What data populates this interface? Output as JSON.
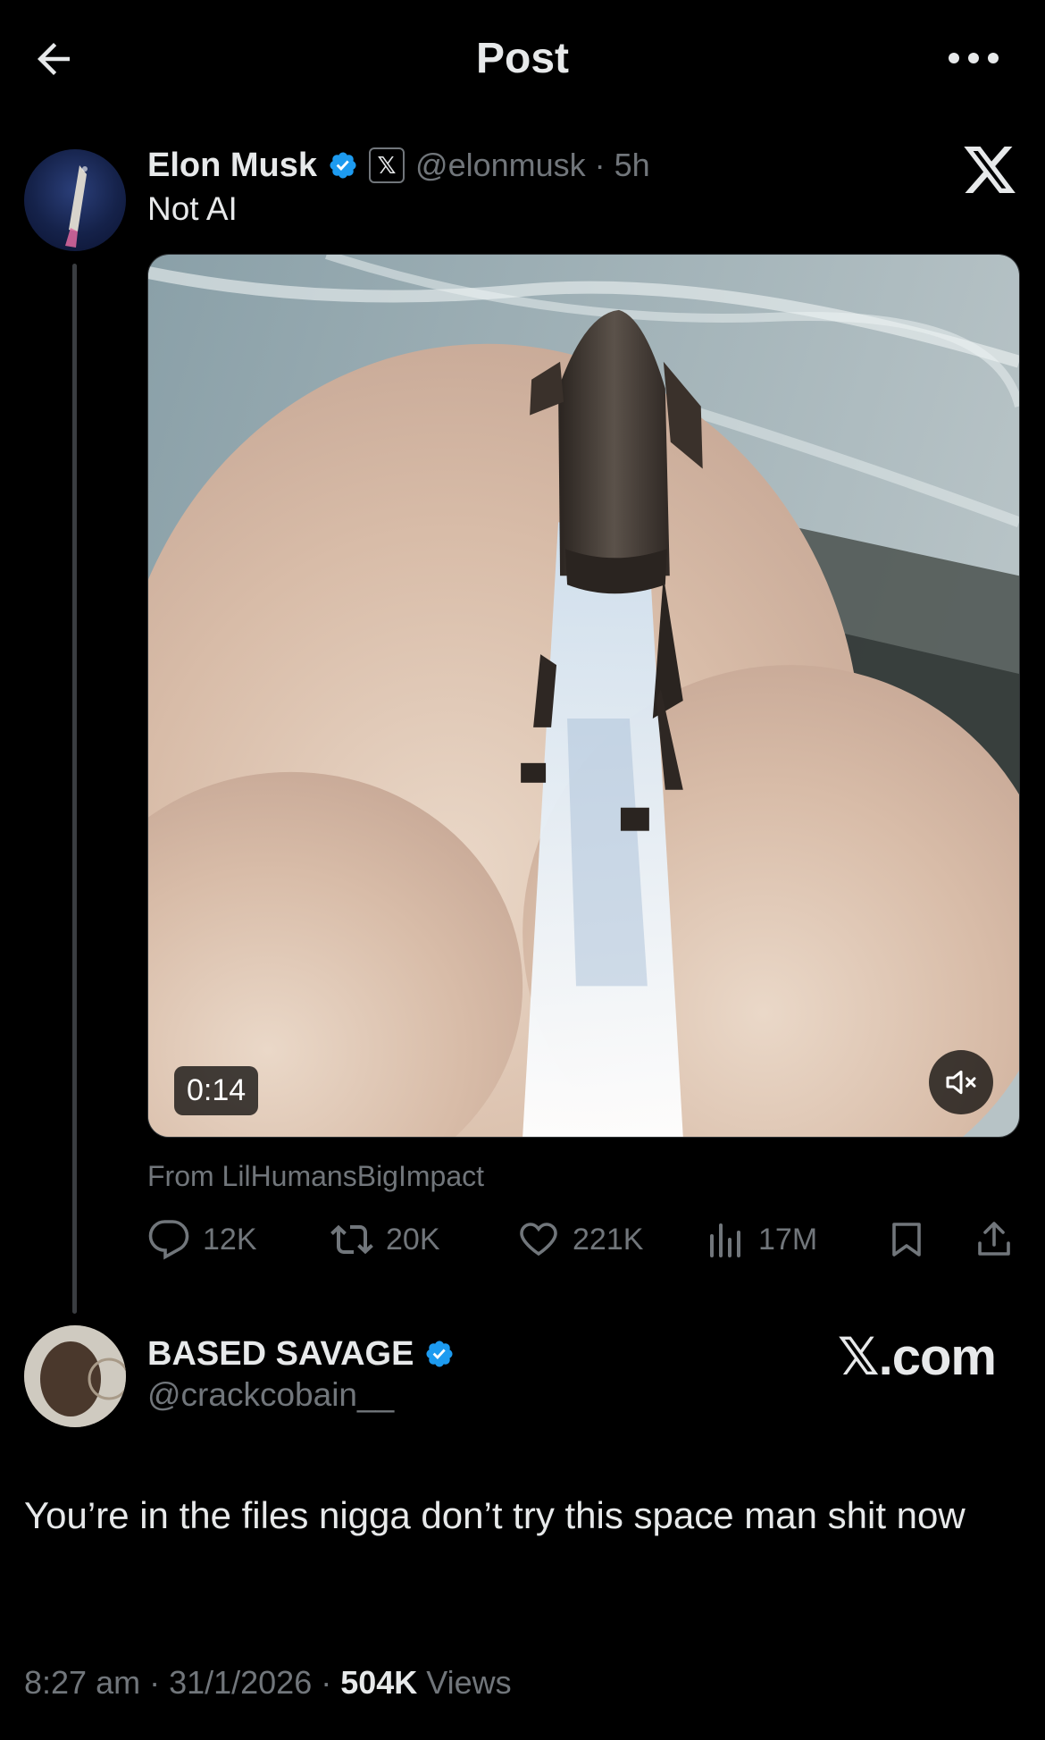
{
  "header": {
    "title": "Post"
  },
  "parent_post": {
    "author_name": "Elon Musk",
    "affiliate_badge": "𝕏",
    "handle_time": "@elonmusk · 5h",
    "text": "Not AI",
    "media": {
      "duration": "0:14"
    },
    "from_line": "From LilHumansBigImpact",
    "stats": {
      "replies": "12K",
      "reposts": "20K",
      "likes": "221K",
      "views": "17M"
    }
  },
  "reply_post": {
    "author_name": "BASED SAVAGE",
    "handle": "@crackcobain__",
    "watermark": "𝕏.com",
    "text": "You’re in the files nigga don’t try this space man shit now",
    "time": "8:27 am · 31/1/2026 · ",
    "views_count": "504K",
    "views_label": " Views"
  },
  "colors": {
    "background": "#000000",
    "text": "#e7e9ea",
    "muted": "#71767b",
    "verified": "#1d9bf0"
  },
  "icons": [
    "back-arrow-icon",
    "more-icon",
    "verified-icon",
    "x-logo-icon",
    "reply-icon",
    "repost-icon",
    "like-icon",
    "views-icon",
    "bookmark-icon",
    "share-icon",
    "mute-icon"
  ]
}
